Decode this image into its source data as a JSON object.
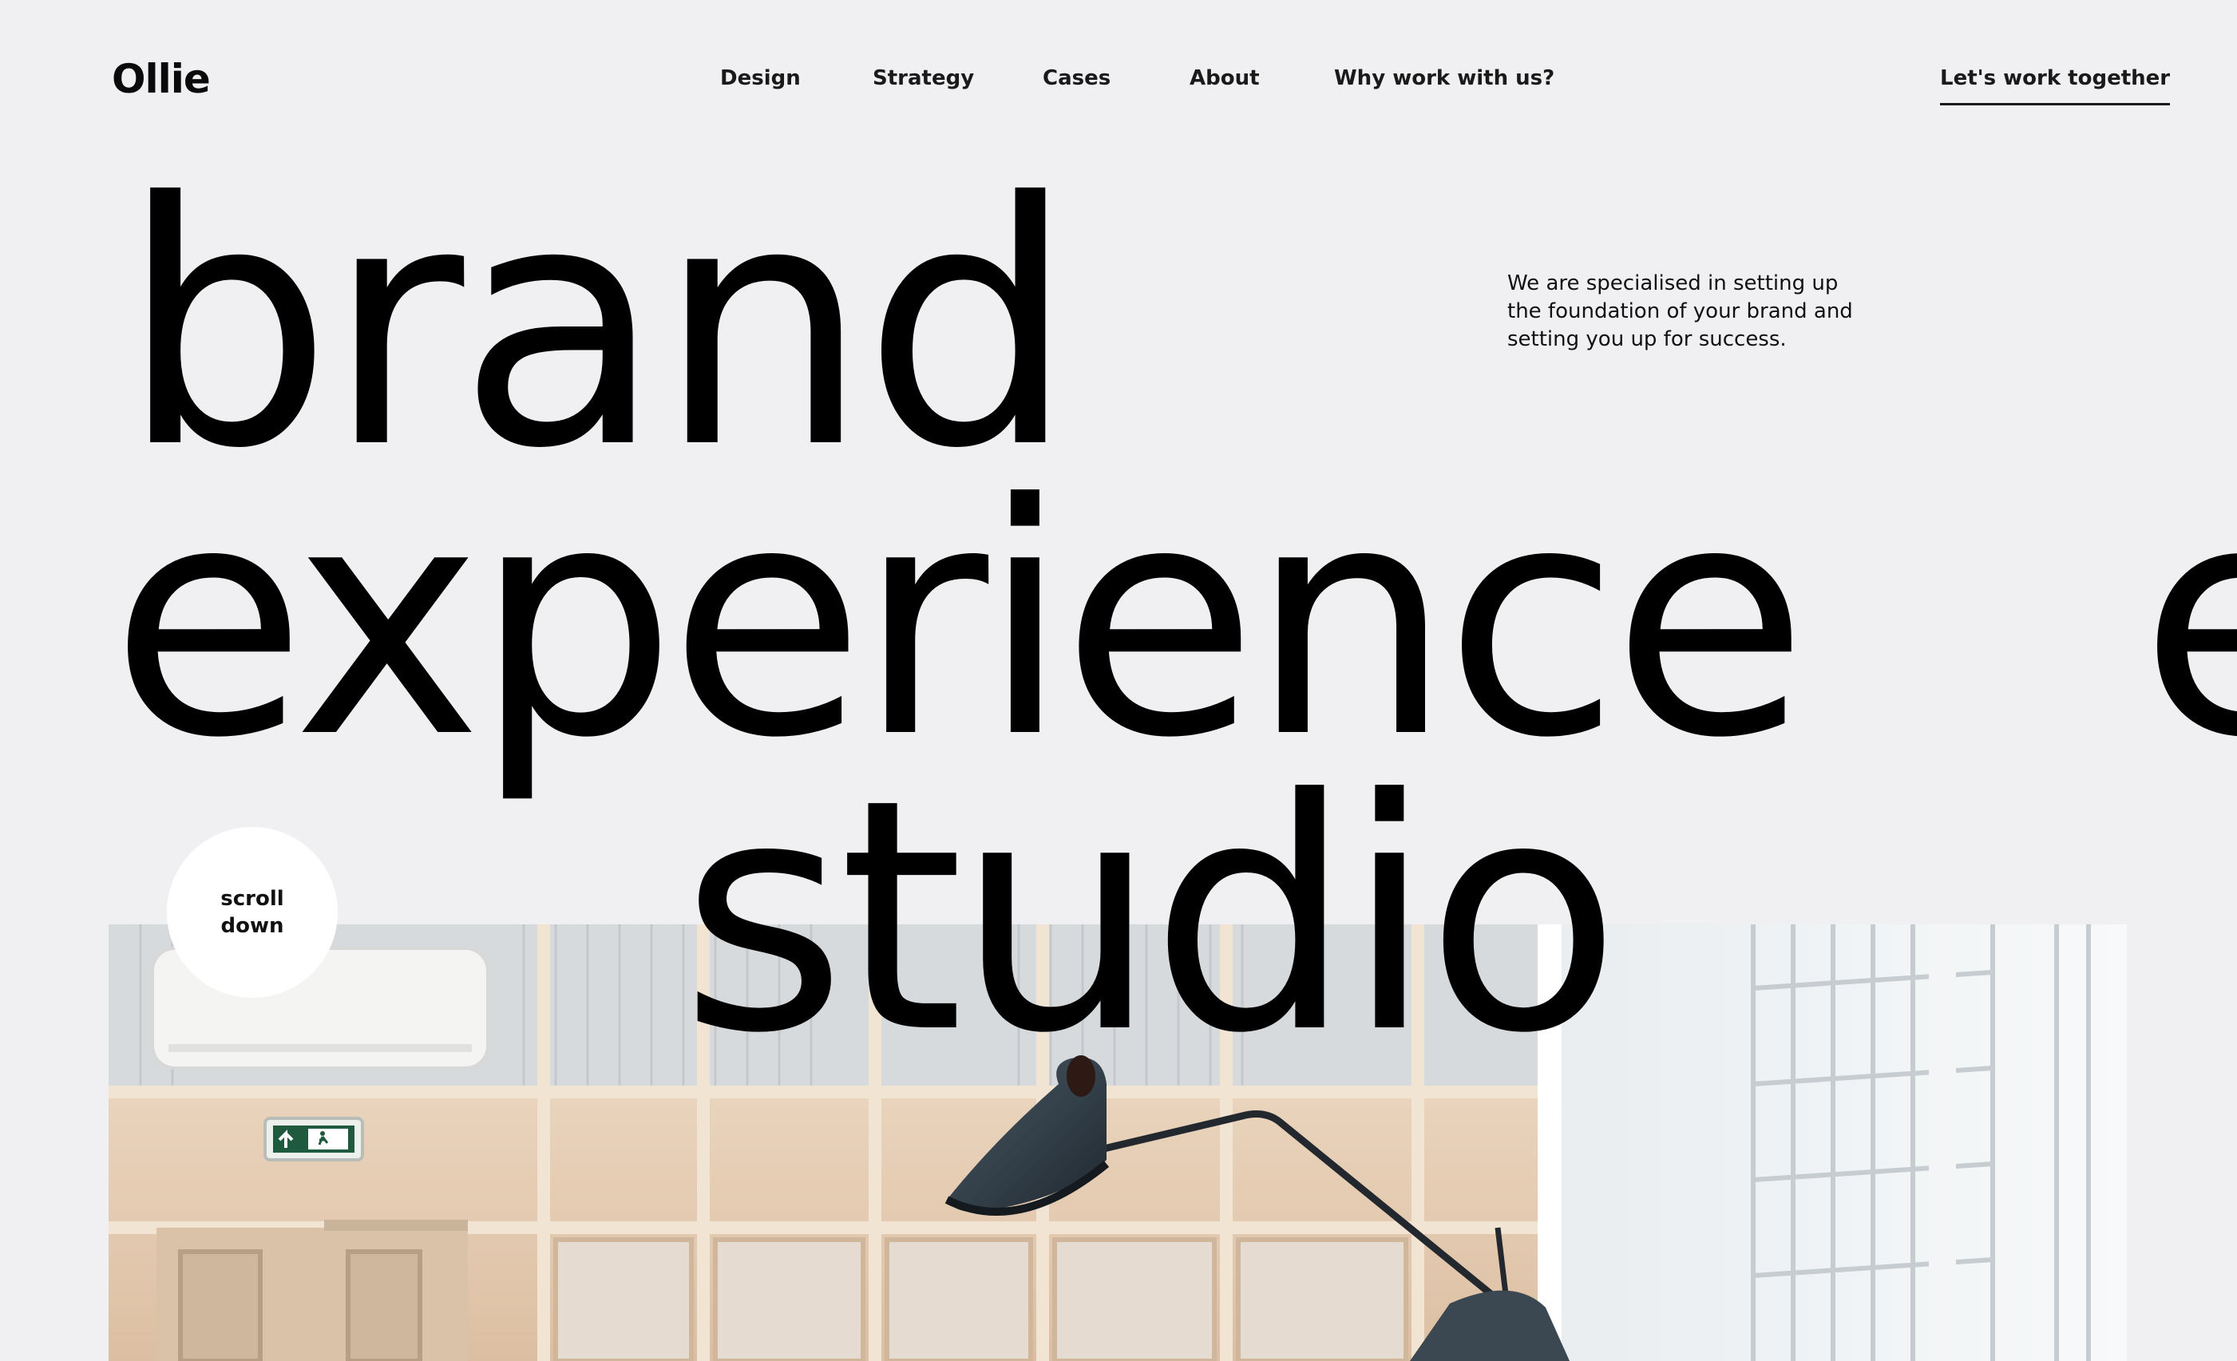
{
  "header": {
    "logo": "Ollie",
    "nav": [
      {
        "label": "Design"
      },
      {
        "label": "Strategy"
      },
      {
        "label": "Cases"
      },
      {
        "label": "About"
      },
      {
        "label": "Why work with us?"
      }
    ],
    "cta_label": "Let's work together"
  },
  "hero": {
    "headline_line1": "brand",
    "headline_line2": "experience",
    "headline_line3": "studio",
    "marquee_fragment": "e",
    "tagline": "We are specialised in setting up the foundation of your brand and setting you up for success.",
    "scroll_label": "scroll down"
  },
  "colors": {
    "background": "#f0f0f2",
    "text": "#0a0a0a",
    "badge": "#ffffff"
  },
  "icons": {
    "exit_sign": "emergency-exit-sign-icon"
  }
}
